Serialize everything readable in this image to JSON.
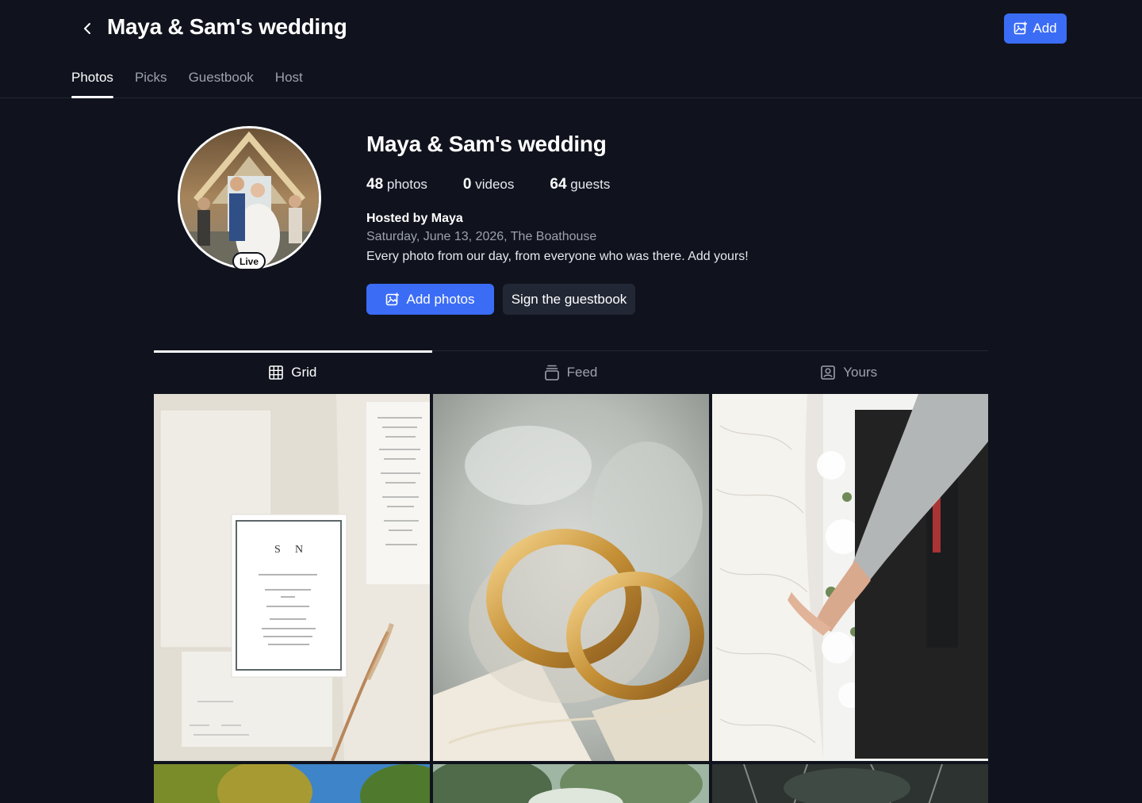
{
  "header": {
    "title": "Maya & Sam's wedding",
    "add_label": "Add",
    "tabs": [
      "Photos",
      "Picks",
      "Guestbook",
      "Host"
    ]
  },
  "profile": {
    "live_badge": "Live",
    "title": "Maya & Sam's wedding",
    "stats": {
      "photos_count": "48",
      "photos_label": "photos",
      "videos_count": "0",
      "videos_label": "videos",
      "guests_count": "64",
      "guests_label": "guests"
    },
    "hosted_by": "Hosted by Maya",
    "date_location": "Saturday, June 13, 2026, The Boathouse",
    "description": "Every photo from our day, from everyone who was there. Add yours!",
    "add_photos_label": "Add photos",
    "guestbook_label": "Sign the guestbook"
  },
  "view_tabs": {
    "grid_label": "Grid",
    "feed_label": "Feed",
    "yours_label": "Yours"
  },
  "colors": {
    "background": "#10131d",
    "accent": "#3b6cf5",
    "secondary_button": "#222735",
    "muted_text": "#9ba1ae"
  },
  "icons": [
    "back-arrow-icon",
    "image-plus-icon",
    "grid-icon",
    "feed-icon",
    "user-square-icon"
  ]
}
